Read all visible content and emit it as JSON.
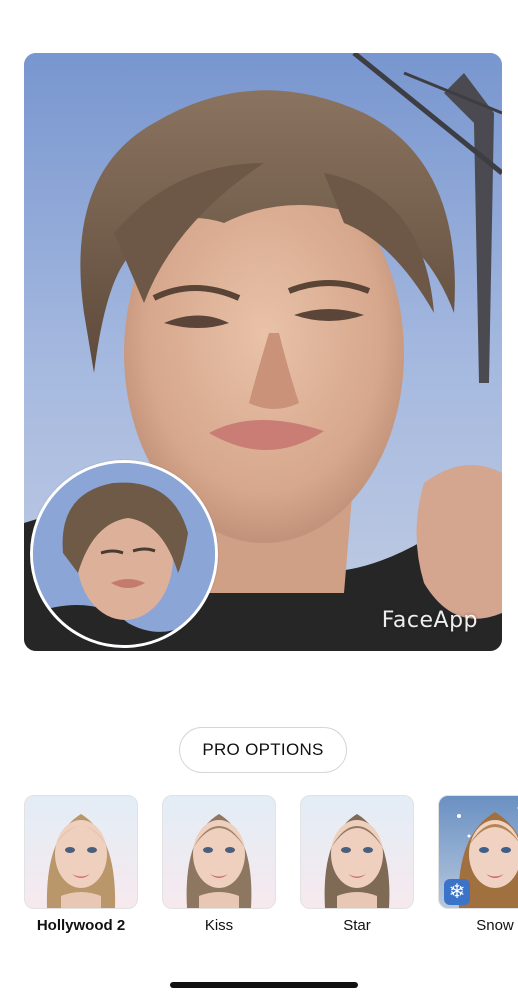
{
  "photo": {
    "watermark": "FaceApp",
    "description_icon": "face-photo"
  },
  "pro_button": {
    "label": "PRO OPTIONS"
  },
  "filters": [
    {
      "label": "Hollywood 2",
      "selected": true
    },
    {
      "label": "Kiss",
      "selected": false
    },
    {
      "label": "Star",
      "selected": false
    },
    {
      "label": "Snow",
      "selected": false,
      "badge_icon": "snowflake-icon"
    }
  ],
  "colors": {
    "sky": "#8aa6d8",
    "accent_snow": "#3b73c9",
    "text": "#111111"
  }
}
